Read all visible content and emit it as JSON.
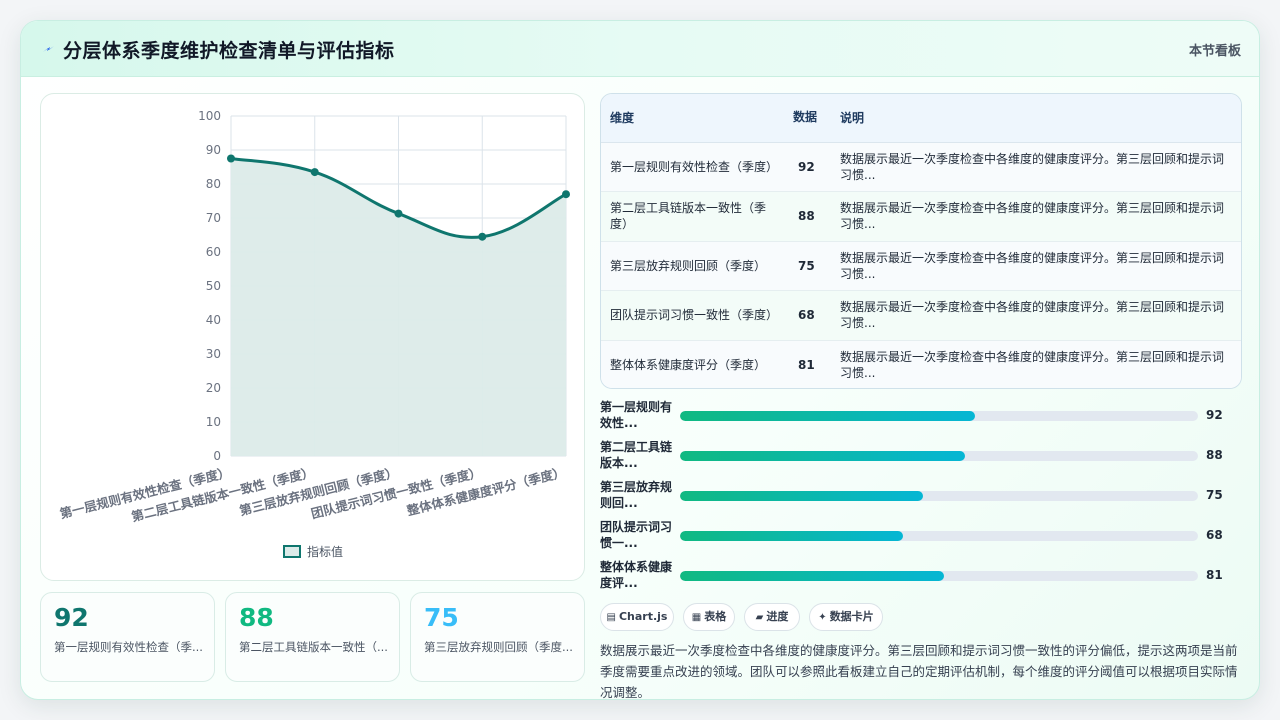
{
  "header": {
    "icon": "lightning-icon",
    "title": "分层体系季度维护检查清单与评估指标",
    "tag": "本节看板"
  },
  "chart_data": {
    "type": "area",
    "categories": [
      "第一层规则有效性检查（季度）",
      "第二层工具链版本一致性（季度）",
      "第三层放弃规则回顾（季度）",
      "团队提示词习惯一致性（季度）",
      "整体体系健康度评分（季度）"
    ],
    "series": [
      {
        "name": "指标值",
        "values": [
          87.5,
          83.5,
          71.3,
          64.5,
          77
        ]
      }
    ],
    "xlabel": "",
    "ylabel": "",
    "ylim": [
      0,
      100
    ],
    "yticks": [
      0,
      10,
      20,
      30,
      40,
      50,
      60,
      70,
      80,
      90,
      100
    ],
    "grid": true,
    "legend": "bottom",
    "colors": {
      "line": "#0f766e",
      "fill": "#dcebe9",
      "grid": "#dbe3ea"
    }
  },
  "stat_cards": [
    {
      "value": "92",
      "label": "第一层规则有效性检查（季...",
      "color": "#0f766e"
    },
    {
      "value": "88",
      "label": "第二层工具链版本一致性（...",
      "color": "#10b981"
    },
    {
      "value": "75",
      "label": "第三层放弃规则回顾（季度...",
      "color": "#38bdf8"
    }
  ],
  "table": {
    "headers": [
      "维度",
      "数据",
      "说明"
    ],
    "rows": [
      {
        "dim": "第一层规则有效性检查（季度）",
        "value": "92",
        "desc": "数据展示最近一次季度检查中各维度的健康度评分。第三层回顾和提示词习惯..."
      },
      {
        "dim": "第二层工具链版本一致性（季度）",
        "value": "88",
        "desc": "数据展示最近一次季度检查中各维度的健康度评分。第三层回顾和提示词习惯..."
      },
      {
        "dim": "第三层放弃规则回顾（季度）",
        "value": "75",
        "desc": "数据展示最近一次季度检查中各维度的健康度评分。第三层回顾和提示词习惯..."
      },
      {
        "dim": "团队提示词习惯一致性（季度）",
        "value": "68",
        "desc": "数据展示最近一次季度检查中各维度的健康度评分。第三层回顾和提示词习惯..."
      },
      {
        "dim": "整体体系健康度评分（季度）",
        "value": "81",
        "desc": "数据展示最近一次季度检查中各维度的健康度评分。第三层回顾和提示词习惯..."
      }
    ]
  },
  "progress": [
    {
      "label": "第一层规则有效性...",
      "value": "92",
      "fill_percent": 57
    },
    {
      "label": "第二层工具链版本...",
      "value": "88",
      "fill_percent": 55
    },
    {
      "label": "第三层放弃规则回...",
      "value": "75",
      "fill_percent": 47
    },
    {
      "label": "团队提示词习惯一...",
      "value": "68",
      "fill_percent": 43
    },
    {
      "label": "整体体系健康度评...",
      "value": "81",
      "fill_percent": 51
    }
  ],
  "chips": [
    {
      "icon": "chart-icon",
      "glyph": "▤",
      "label": "Chart.js"
    },
    {
      "icon": "table-icon",
      "glyph": "▦",
      "label": "表格"
    },
    {
      "icon": "progress-icon",
      "glyph": "▰",
      "label": "进度"
    },
    {
      "icon": "sparkle-icon",
      "glyph": "✦",
      "label": "数据卡片"
    }
  ],
  "summary": "数据展示最近一次季度检查中各维度的健康度评分。第三层回顾和提示词习惯一致性的评分偏低，提示这两项是当前季度需要重点改进的领域。团队可以参照此看板建立自己的定期评估机制，每个维度的评分阈值可以根据项目实际情况调整。"
}
